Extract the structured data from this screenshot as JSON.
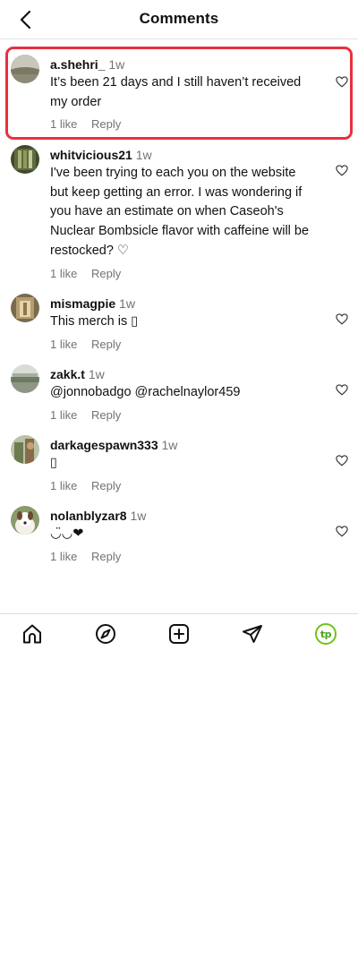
{
  "header": {
    "title": "Comments",
    "back_icon": "chevron-left-icon"
  },
  "comments": [
    {
      "username": "a.shehri_",
      "time": "1w",
      "text": "It’s been 21 days and I still haven’t received my order",
      "likes": "1 like",
      "reply": "Reply",
      "highlighted": true
    },
    {
      "username": "whitvicious21",
      "time": "1w",
      "text": "I've been trying to each you on the website but keep getting an error. I was wondering if you have an estimate on when Caseoh's Nuclear Bombsicle flavor with caffeine will be restocked? ♡",
      "likes": "1 like",
      "reply": "Reply"
    },
    {
      "username": "mismagpie",
      "time": "1w",
      "text": "This merch is ▯",
      "likes": "1 like",
      "reply": "Reply"
    },
    {
      "username": "zakk.t",
      "time": "1w",
      "text": "@jonnobadgo @rachelnaylor459",
      "likes": "1 like",
      "reply": "Reply"
    },
    {
      "username": "darkagespawn333",
      "time": "1w",
      "text": "▯",
      "likes": "1 like",
      "reply": "Reply"
    },
    {
      "username": "nolanblyzar8",
      "time": "1w",
      "text": "◡̈◡❤",
      "likes": "1 like",
      "reply": "Reply"
    }
  ],
  "nav": {
    "items": [
      "home-icon",
      "explore-compass-icon",
      "create-plus-icon",
      "direct-send-icon",
      "profile-avatar-tp"
    ],
    "profile_initials": "tp"
  },
  "colors": {
    "highlight_border": "#e8303e",
    "secondary_text": "#737373",
    "profile_green": "#6fc21a"
  }
}
